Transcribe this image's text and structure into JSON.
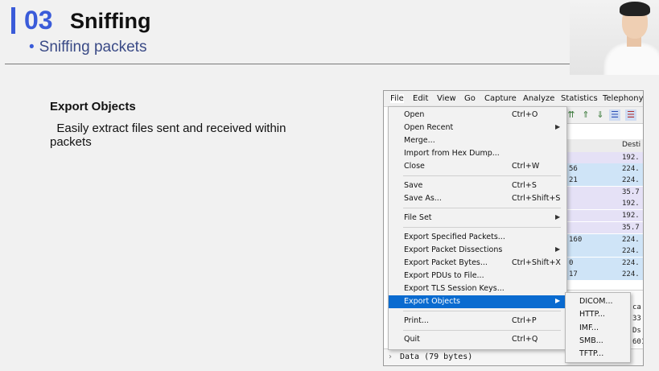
{
  "slide": {
    "section_number": "03",
    "section_title": "Sniffing",
    "subtitle": "Sniffing packets",
    "content_title": "Export Objects",
    "content_body": "Easily extract files sent and received within packets"
  },
  "menubar": [
    "File",
    "Edit",
    "View",
    "Go",
    "Capture",
    "Analyze",
    "Statistics",
    "Telephony"
  ],
  "file_menu": [
    {
      "label": "Open",
      "shortcut": "Ctrl+O",
      "submenu": false
    },
    {
      "label": "Open Recent",
      "shortcut": "",
      "submenu": true
    },
    {
      "label": "Merge...",
      "shortcut": "",
      "submenu": false
    },
    {
      "label": "Import from Hex Dump...",
      "shortcut": "",
      "submenu": false
    },
    {
      "label": "Close",
      "shortcut": "Ctrl+W",
      "submenu": false
    },
    {
      "label": "Save",
      "shortcut": "Ctrl+S",
      "submenu": false
    },
    {
      "label": "Save As...",
      "shortcut": "Ctrl+Shift+S",
      "submenu": false
    },
    {
      "label": "File Set",
      "shortcut": "",
      "submenu": true
    },
    {
      "label": "Export Specified Packets...",
      "shortcut": "",
      "submenu": false
    },
    {
      "label": "Export Packet Dissections",
      "shortcut": "",
      "submenu": true
    },
    {
      "label": "Export Packet Bytes...",
      "shortcut": "Ctrl+Shift+X",
      "submenu": false
    },
    {
      "label": "Export PDUs to File...",
      "shortcut": "",
      "submenu": false
    },
    {
      "label": "Export TLS Session Keys...",
      "shortcut": "",
      "submenu": false
    },
    {
      "label": "Export Objects",
      "shortcut": "",
      "submenu": true,
      "highlighted": true
    },
    {
      "label": "Print...",
      "shortcut": "Ctrl+P",
      "submenu": false
    },
    {
      "label": "Quit",
      "shortcut": "Ctrl+Q",
      "submenu": false
    }
  ],
  "export_objects_submenu": [
    "DICOM...",
    "HTTP...",
    "IMF...",
    "SMB...",
    "TFTP..."
  ],
  "packet_list": {
    "column_header": "Desti",
    "rows": [
      {
        "a": "",
        "b": "192."
      },
      {
        "a": "56",
        "b": "224."
      },
      {
        "a": "21",
        "b": "224."
      },
      {
        "a": "",
        "b": "35.7"
      },
      {
        "a": "",
        "b": "192."
      },
      {
        "a": "",
        "b": "192."
      },
      {
        "a": "",
        "b": "35.7"
      },
      {
        "a": "160",
        "b": "224."
      },
      {
        "a": "",
        "b": "224."
      },
      {
        "a": "0",
        "b": "224."
      },
      {
        "a": "17",
        "b": "224."
      }
    ]
  },
  "detail_fragments": [
    "ca",
    "33:",
    "Ds",
    "601"
  ],
  "bytes_pane": {
    "chevron": "›",
    "text": "Data (79 bytes)"
  },
  "icons": {
    "submenu_arrow": "▶",
    "webcam": "presenter-webcam"
  },
  "colors": {
    "accent": "#3a5bd9",
    "menu_highlight": "#0a6bd0",
    "row_blue": "#cfe4f7",
    "row_purple": "#e5e1f6"
  }
}
